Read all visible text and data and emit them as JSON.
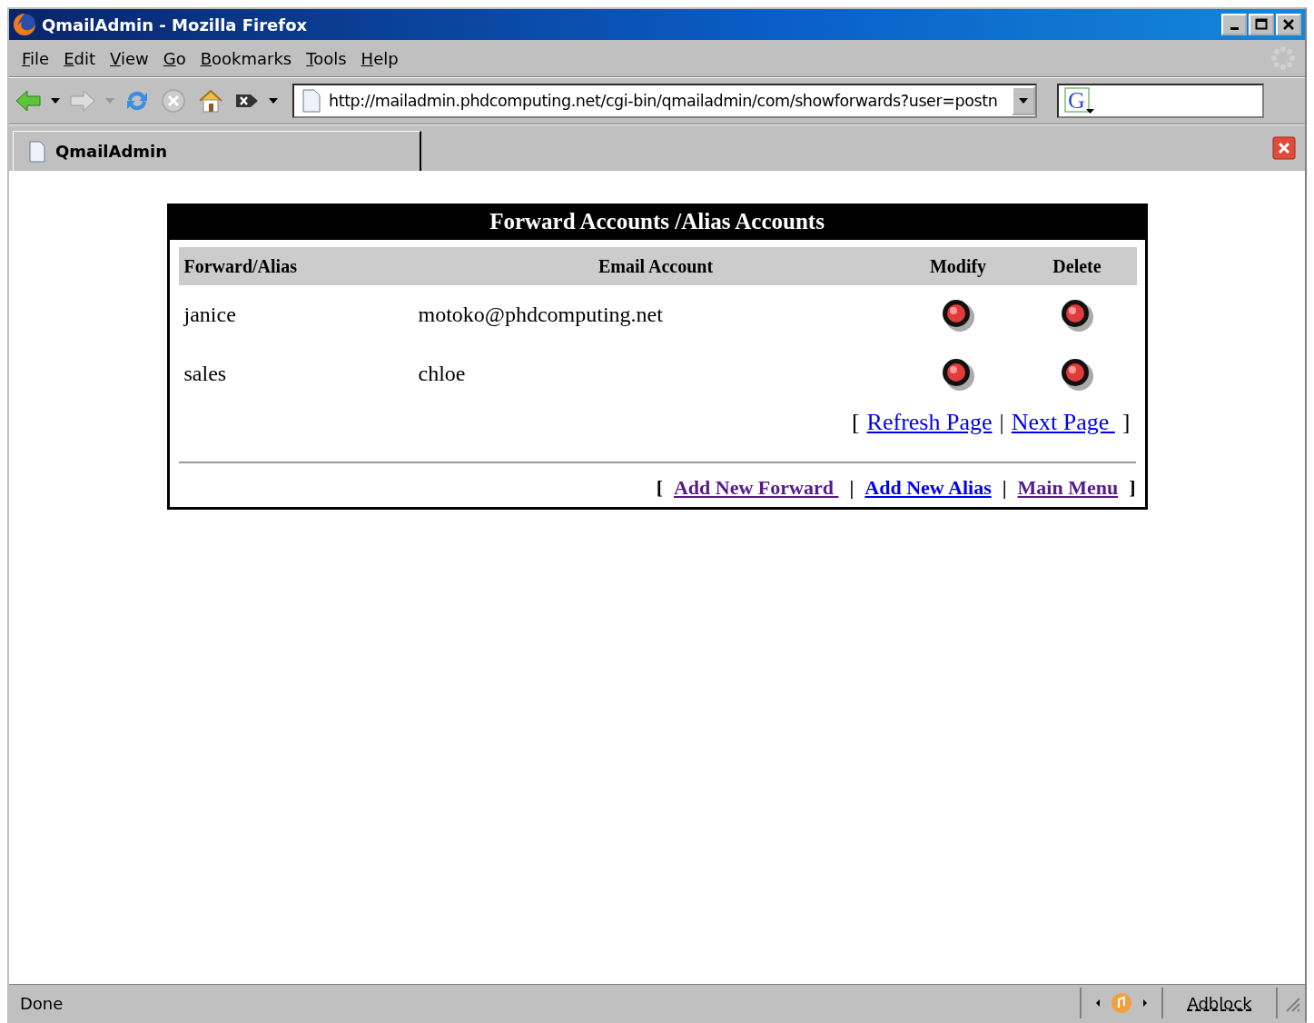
{
  "window": {
    "title": "QmailAdmin - Mozilla Firefox"
  },
  "menu": [
    {
      "label": "File"
    },
    {
      "label": "Edit"
    },
    {
      "label": "View"
    },
    {
      "label": "Go"
    },
    {
      "label": "Bookmarks"
    },
    {
      "label": "Tools"
    },
    {
      "label": "Help"
    }
  ],
  "toolbar": {
    "address": "http://mailadmin.phdcomputing.net/cgi-bin/qmailadmin/com/showforwards?user=postn",
    "search_engine": "G"
  },
  "tabs": [
    {
      "label": "QmailAdmin",
      "selected": true
    }
  ],
  "panel": {
    "title": "Forward Accounts /Alias Accounts",
    "columns": [
      "Forward/Alias",
      "Email Account",
      "Modify",
      "Delete"
    ],
    "rows": [
      {
        "alias": "janice",
        "account": "motoko@phdcomputing.net"
      },
      {
        "alias": "sales",
        "account": "chloe"
      }
    ],
    "pager": [
      {
        "kind": "text",
        "label": "["
      },
      {
        "kind": "link",
        "label": "Refresh Page",
        "visited": false
      },
      {
        "kind": "text",
        "label": "|"
      },
      {
        "kind": "link",
        "label": "Next Page ",
        "visited": false
      },
      {
        "kind": "text",
        "label": "]"
      }
    ],
    "actions": [
      {
        "kind": "text",
        "label": "["
      },
      {
        "kind": "link",
        "label": "Add New Forward ",
        "visited": true
      },
      {
        "kind": "text",
        "label": "|"
      },
      {
        "kind": "link",
        "label": "Add New Alias",
        "visited": false
      },
      {
        "kind": "text",
        "label": "|"
      },
      {
        "kind": "link",
        "label": "Main Menu",
        "visited": true
      },
      {
        "kind": "text",
        "label": "]"
      }
    ]
  },
  "status_bar": {
    "text": "Done",
    "addon": "Adblock"
  }
}
